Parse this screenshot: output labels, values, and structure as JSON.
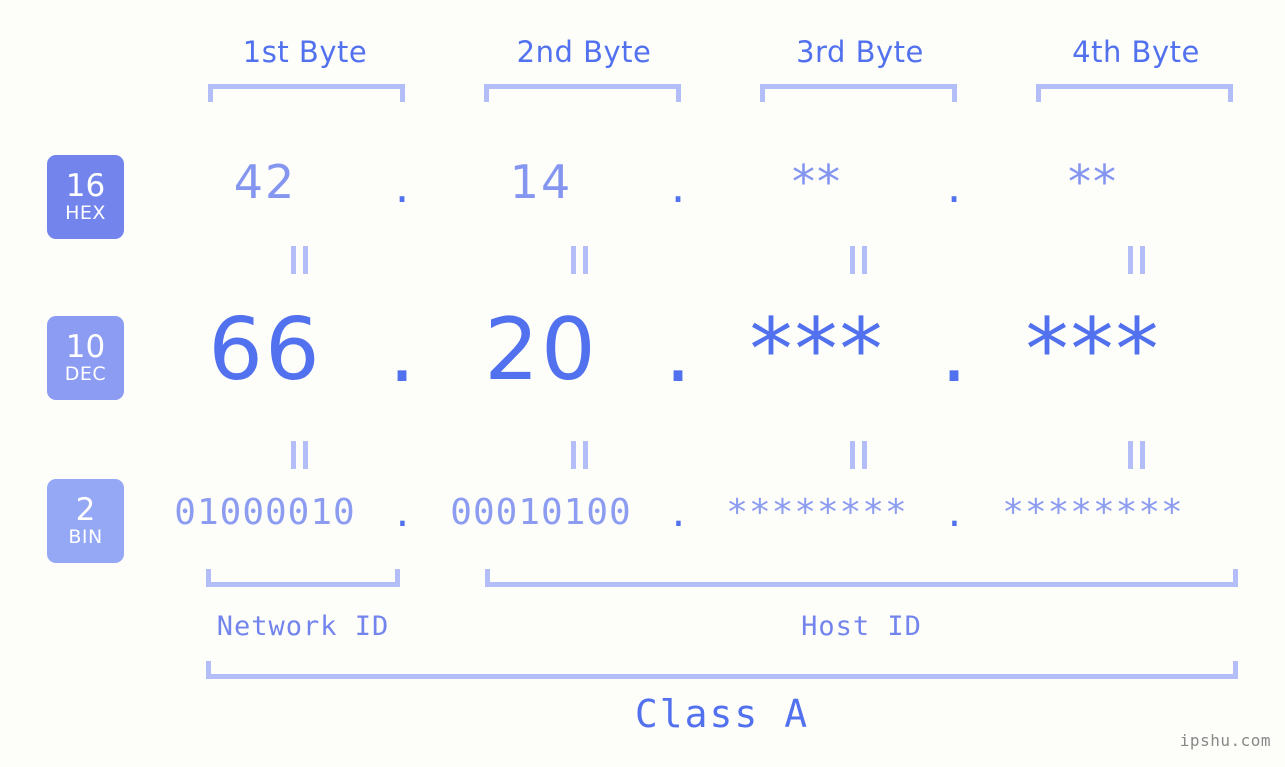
{
  "watermark": "ipshu.com",
  "header": {
    "byte_labels": [
      "1st Byte",
      "2nd Byte",
      "3rd Byte",
      "4th Byte"
    ]
  },
  "radix_badges": [
    {
      "num": "16",
      "sub": "HEX",
      "color": "#7385ed"
    },
    {
      "num": "10",
      "sub": "DEC",
      "color": "#8b9cf2"
    },
    {
      "num": "2",
      "sub": "BIN",
      "color": "#95a8f5"
    }
  ],
  "rows": {
    "hex": {
      "values": [
        "42",
        "14",
        "**",
        "**"
      ],
      "separator": "."
    },
    "dec": {
      "values": [
        "66",
        "20",
        "***",
        "***"
      ],
      "separator": "."
    },
    "bin": {
      "values": [
        "01000010",
        "00010100",
        "********",
        "********"
      ],
      "separator": "."
    }
  },
  "sections": {
    "network_id": "Network ID",
    "host_id": "Host ID",
    "class": "Class A"
  },
  "colors": {
    "background": "#fdfdfa",
    "primary_blue": "#5271ee",
    "light_blue": "#8496f0",
    "bracket_blue": "#b3bdf7",
    "watermark_gray": "#888888"
  }
}
